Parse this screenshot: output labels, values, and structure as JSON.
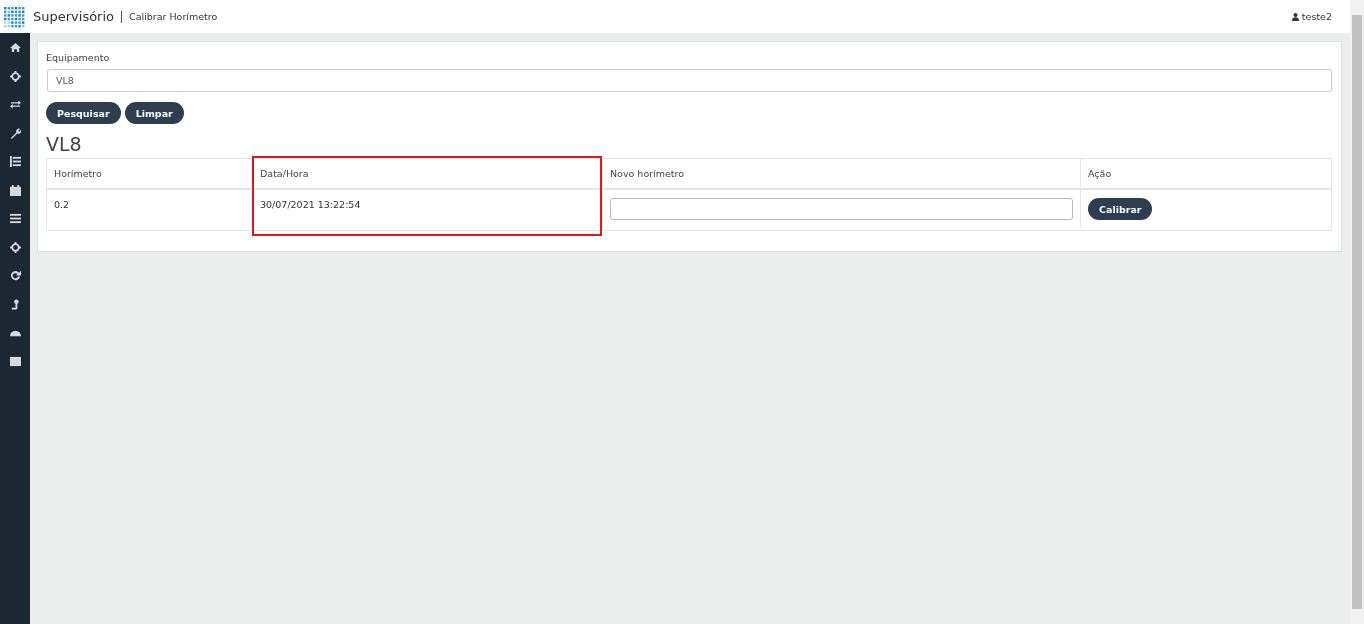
{
  "header": {
    "app_name": "Supervisório",
    "page_title": "Calibrar Horímetro",
    "user": "teste2"
  },
  "filter": {
    "label": "Equipamento",
    "value": "VL8",
    "buttons": [
      "Pesquisar",
      "Limpar"
    ]
  },
  "result": {
    "title": "VL8",
    "columns": [
      {
        "label": "Horímetro",
        "highlighted": false
      },
      {
        "label": "Data/Hora",
        "highlighted": true
      },
      {
        "label": "Novo horímetro",
        "highlighted": false
      },
      {
        "label": "Ação",
        "highlighted": false
      }
    ],
    "rows": [
      {
        "horimetro": "0.2",
        "data_hora": "30/07/2021 13:22:54",
        "novo_horimetro": "",
        "action": "Calibrar"
      }
    ]
  }
}
